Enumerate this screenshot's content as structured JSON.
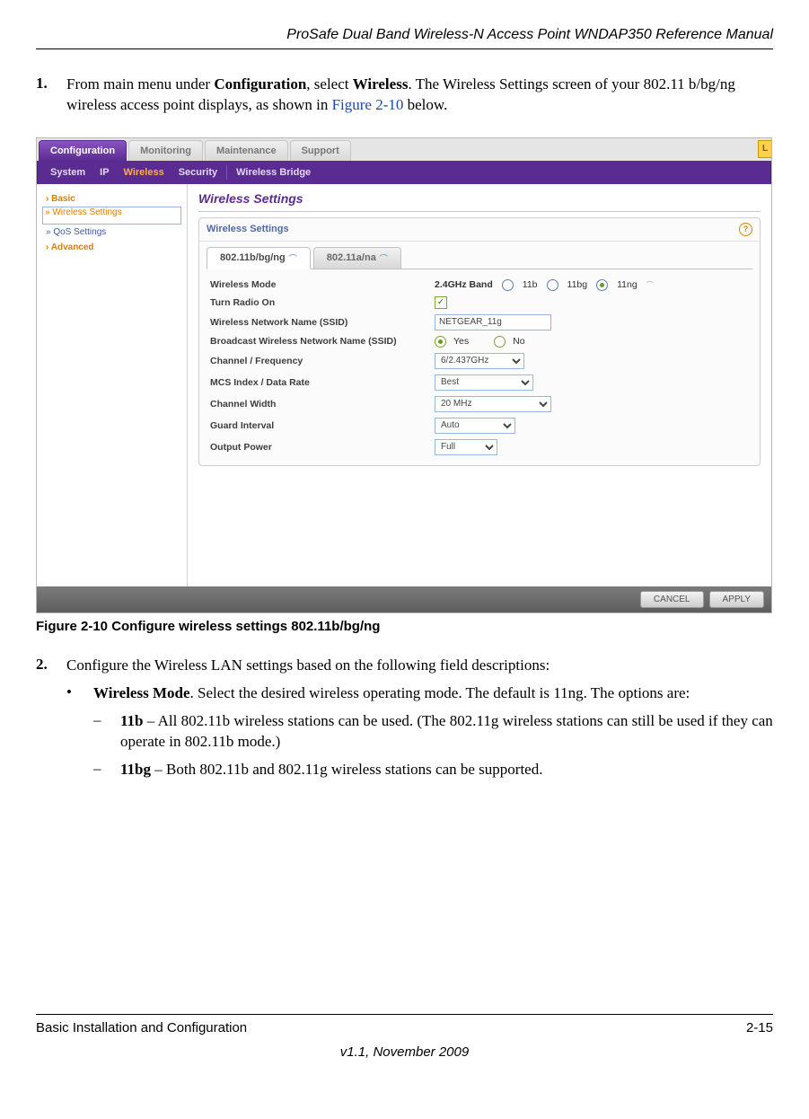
{
  "header": {
    "title": "ProSafe Dual Band Wireless-N Access Point WNDAP350 Reference Manual"
  },
  "step1": {
    "num": "1.",
    "pre": "From main menu under ",
    "b1": "Configuration",
    "mid": ", select ",
    "b2": "Wireless",
    "post1": ". The Wireless Settings screen of your 802.11 b/bg/ng wireless access point displays, as shown in ",
    "figref": "Figure 2-10",
    "post2": " below."
  },
  "figcaption": "Figure 2-10  Configure wireless settings 802.11b/bg/ng",
  "step2": {
    "num": "2.",
    "text": "Configure the Wireless LAN settings based on the following field descriptions:"
  },
  "bullet_mode": {
    "mark": "•",
    "b": "Wireless Mode",
    "rest": ". Select the desired wireless operating mode. The default is 11ng. The options are:"
  },
  "dash_11b": {
    "mark": "–",
    "b": "11b",
    "rest": " – All 802.11b wireless stations can be used. (The 802.11g wireless stations can still be used if they can operate in 802.11b mode.)"
  },
  "dash_11bg": {
    "mark": "–",
    "b": "11bg",
    "rest": " – Both 802.11b and 802.11g wireless stations can be supported."
  },
  "footer": {
    "left": "Basic Installation and Configuration",
    "right": "2-15",
    "ver": "v1.1, November 2009"
  },
  "ui": {
    "tabs_primary": [
      "Configuration",
      "Monitoring",
      "Maintenance",
      "Support"
    ],
    "corner": "L",
    "tabs_secondary": [
      "System",
      "IP",
      "Wireless",
      "Security",
      "Wireless Bridge"
    ],
    "sidebar": {
      "basic": "Basic",
      "wireless_settings": "» Wireless Settings",
      "qos": "» QoS Settings",
      "advanced": "Advanced"
    },
    "panel_title": "Wireless Settings",
    "panel_head": "Wireless Settings",
    "band_tabs": {
      "bgng": "802.11b/bg/ng",
      "ana": "802.11a/na"
    },
    "rows": {
      "mode": {
        "label": "Wireless Mode",
        "band": "2.4GHz Band",
        "r1": "11b",
        "r2": "11bg",
        "r3": "11ng"
      },
      "radio": {
        "label": "Turn Radio On"
      },
      "ssid": {
        "label": "Wireless Network Name (SSID)",
        "value": "NETGEAR_11g"
      },
      "bcast": {
        "label": "Broadcast Wireless Network Name (SSID)",
        "yes": "Yes",
        "no": "No"
      },
      "chan": {
        "label": "Channel / Frequency",
        "value": "6/2.437GHz"
      },
      "mcs": {
        "label": "MCS Index / Data Rate",
        "value": "Best"
      },
      "width": {
        "label": "Channel Width",
        "value": "20 MHz"
      },
      "guard": {
        "label": "Guard Interval",
        "value": "Auto"
      },
      "power": {
        "label": "Output Power",
        "value": "Full"
      }
    },
    "buttons": {
      "cancel": "CANCEL",
      "apply": "APPLY"
    }
  }
}
